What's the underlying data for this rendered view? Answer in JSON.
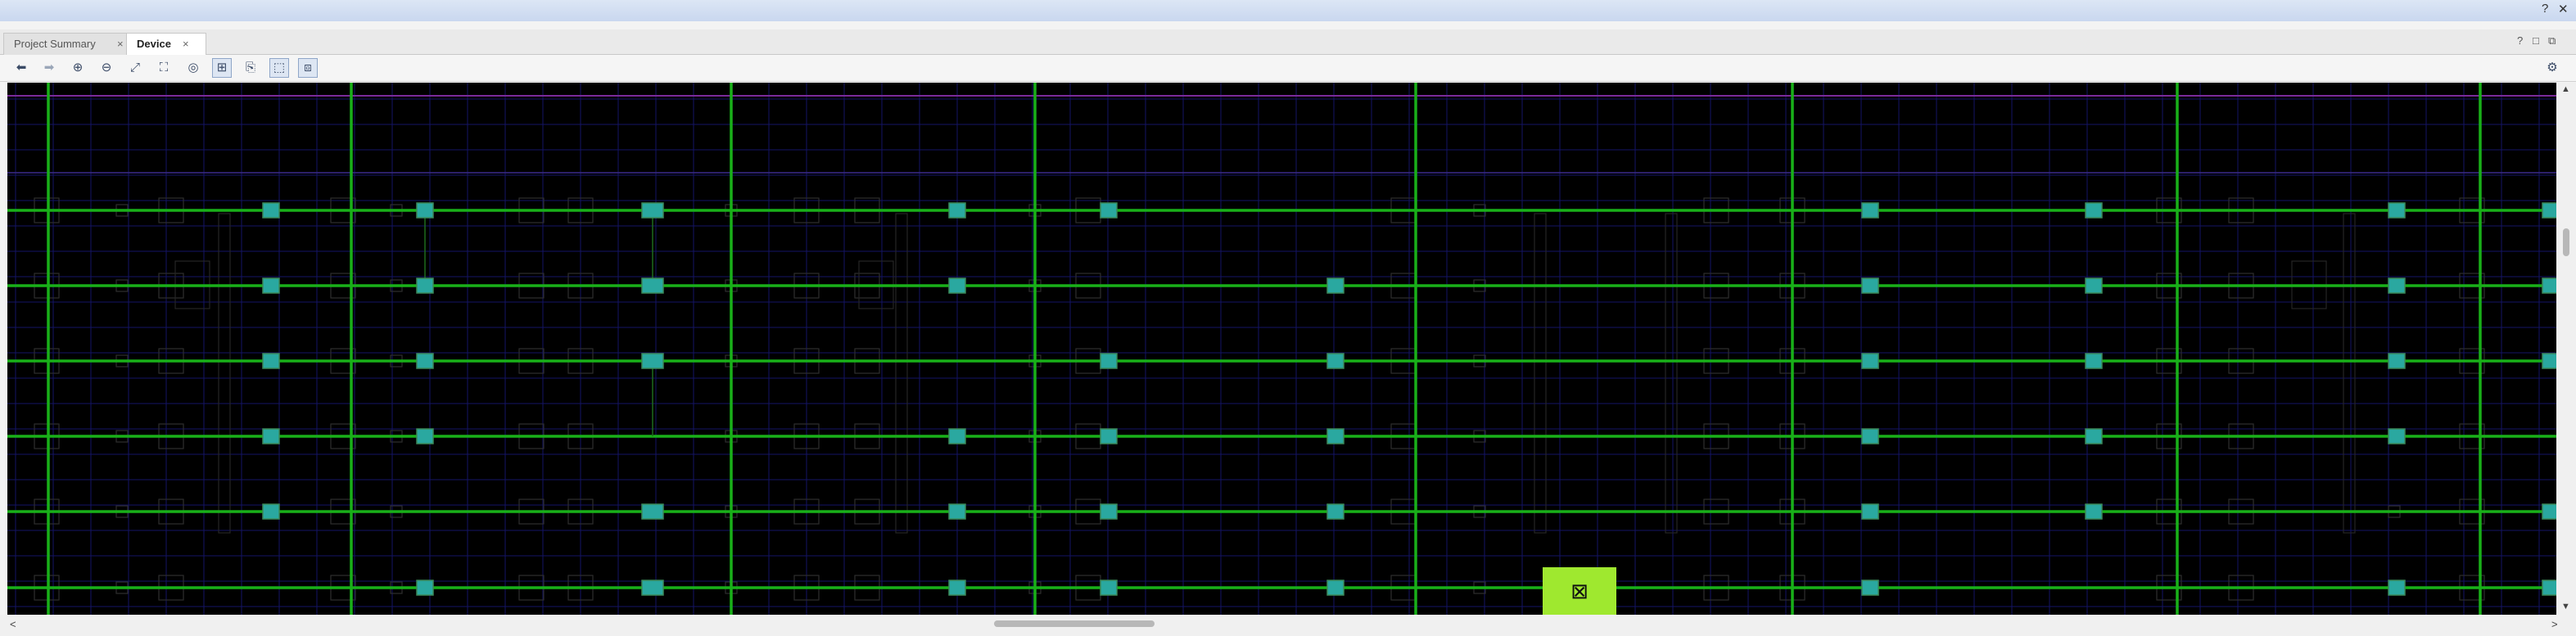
{
  "window": {
    "help_icon": "?",
    "close_icon": "✕"
  },
  "tabs": [
    {
      "label": "Project Summary",
      "active": false
    },
    {
      "label": "Device",
      "active": true
    }
  ],
  "tab_controls": {
    "help": "?",
    "restore": "□",
    "maximize": "⧉"
  },
  "toolbar": {
    "buttons": [
      {
        "name": "back-icon",
        "glyph": "⬅"
      },
      {
        "name": "forward-icon",
        "glyph": "➡"
      },
      {
        "name": "zoom-in-icon",
        "glyph": "⊕"
      },
      {
        "name": "zoom-out-icon",
        "glyph": "⊖"
      },
      {
        "name": "zoom-fit-icon",
        "glyph": "⤢"
      },
      {
        "name": "zoom-selection-icon",
        "glyph": "⛶"
      },
      {
        "name": "auto-fit-icon",
        "glyph": "◎"
      },
      {
        "name": "routing-resources-icon",
        "glyph": "⊞"
      },
      {
        "name": "reports-icon",
        "glyph": "⎘"
      },
      {
        "name": "select-area-icon",
        "glyph": "⬚"
      },
      {
        "name": "highlight-icon",
        "glyph": "⧈"
      }
    ],
    "settings_icon": "⚙"
  },
  "device": {
    "colors": {
      "background": "#000000",
      "clock_line": "#19b019",
      "site_fill": "#2aa8a0",
      "site_border": "#3a8a5a",
      "selected": "#9fe82f",
      "purple_line": "#7a2a9a",
      "grid_blue": "#141466"
    },
    "selected_marker": "⊠"
  },
  "scroll": {
    "up": "▲",
    "down": "▼",
    "left": "<",
    "right": ">"
  }
}
